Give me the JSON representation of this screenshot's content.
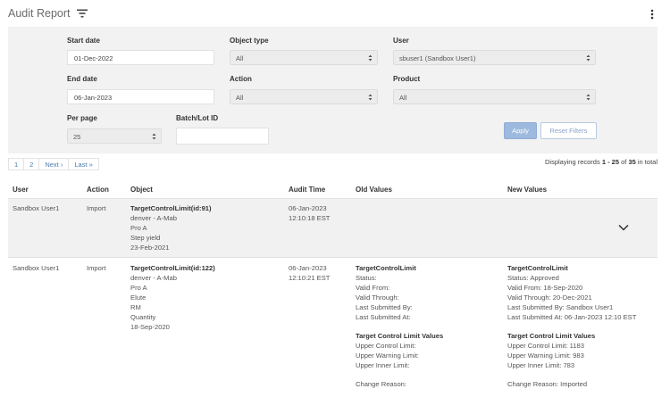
{
  "header": {
    "title": "Audit Report"
  },
  "filters": {
    "start_date_label": "Start date",
    "start_date_value": "01-Dec-2022",
    "end_date_label": "End date",
    "end_date_value": "06-Jan-2023",
    "object_type_label": "Object type",
    "object_type_value": "All",
    "action_label": "Action",
    "action_value": "All",
    "user_label": "User",
    "user_value": "sbuser1 (Sandbox User1)",
    "product_label": "Product",
    "product_value": "All",
    "per_page_label": "Per page",
    "per_page_value": "25",
    "batch_label": "Batch/Lot ID",
    "batch_value": "",
    "apply_label": "Apply",
    "reset_label": "Reset Filters"
  },
  "pagination": {
    "pages": [
      "1",
      "2"
    ],
    "next_label": "Next ›",
    "last_label": "Last »",
    "records_prefix": "Displaying records",
    "records_range": "1 - 25",
    "records_of": "of",
    "records_total": "35",
    "records_suffix": "in total"
  },
  "table": {
    "columns": [
      "User",
      "Action",
      "Object",
      "Audit Time",
      "Old Values",
      "New Values"
    ],
    "rows": [
      {
        "user": "Sandbox User1",
        "action": "Import",
        "object_title": "TargetControlLimit(id:91)",
        "object_lines": [
          "denver - A-Mab",
          "Pro A",
          "Step yield",
          "23-Feb-2021"
        ],
        "time_lines": [
          "06-Jan-2023",
          "12:10:18 EST"
        ]
      },
      {
        "user": "Sandbox User1",
        "action": "Import",
        "object_title": "TargetControlLimit(id:122)",
        "object_lines": [
          "denver - A-Mab",
          "Pro A",
          "Elute",
          "RM",
          "Quantity",
          "18-Sep-2020"
        ],
        "time_lines": [
          "06-Jan-2023",
          "12:10:21 EST"
        ],
        "old_title": "TargetControlLimit",
        "old_lines": [
          "Status:",
          "Valid From:",
          "Valid Through:",
          "Last Submitted By:",
          "Last Submitted At:"
        ],
        "old_title2": "Target Control Limit Values",
        "old_lines2": [
          "Upper Control Limit:",
          "Upper Warning Limit:",
          "Upper Inner Limit:"
        ],
        "old_reason": "Change Reason:",
        "new_title": "TargetControlLimit",
        "new_lines": [
          "Status: Approved",
          "Valid From: 18-Sep-2020",
          "Valid Through: 20-Dec-2021",
          "Last Submitted By: Sandbox User1",
          "Last Submitted At: 06-Jan-2023 12:10 EST"
        ],
        "new_title2": "Target Control Limit Values",
        "new_lines2": [
          "Upper Control Limit: 1183",
          "Upper Warning Limit: 983",
          "Upper Inner Limit: 783"
        ],
        "new_reason": "Change Reason: Imported"
      }
    ]
  }
}
